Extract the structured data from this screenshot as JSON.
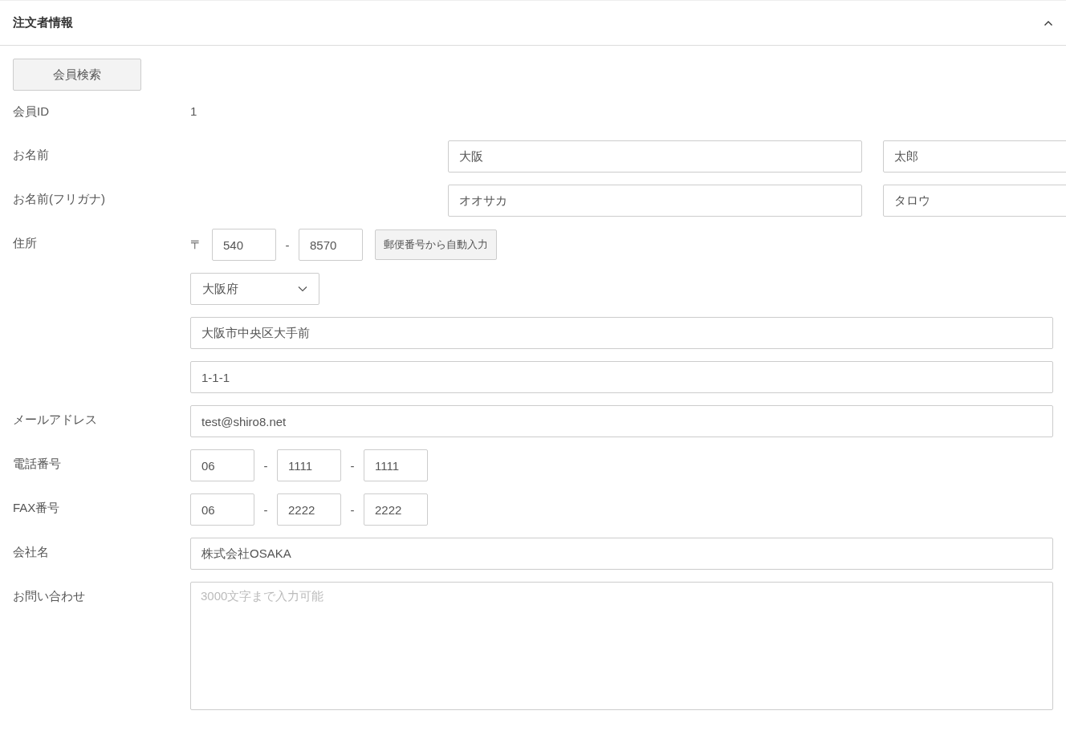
{
  "panel": {
    "title": "注文者情報",
    "expanded": true,
    "search_button": "会員検索"
  },
  "rows": [
    {
      "kind": "text",
      "label": "会員ID",
      "value": "1"
    },
    {
      "kind": "pair",
      "label": "お名前",
      "values": [
        "大阪",
        "太郎"
      ]
    },
    {
      "kind": "pair",
      "label": "お名前(フリガナ)",
      "values": [
        "オオサカ",
        "タロウ"
      ]
    },
    {
      "kind": "address",
      "label": "住所",
      "postal_mark": "〒",
      "zip": [
        "540",
        "8570"
      ],
      "zip_separator": "-",
      "autofill_button": "郵便番号から自動入力",
      "prefecture": "大阪府",
      "city": "大阪市中央区大手前",
      "street": "1-1-1"
    },
    {
      "kind": "wide",
      "label": "メールアドレス",
      "value": "test@shiro8.net"
    },
    {
      "kind": "phone",
      "label": "電話番号",
      "parts": [
        "06",
        "1111",
        "1111"
      ],
      "separators": [
        "-",
        "-"
      ]
    },
    {
      "kind": "phone",
      "label": "FAX番号",
      "parts": [
        "06",
        "2222",
        "2222"
      ],
      "separators": [
        "-",
        "-"
      ]
    },
    {
      "kind": "wide",
      "label": "会社名",
      "value": "株式会社OSAKA"
    },
    {
      "kind": "textarea",
      "label": "お問い合わせ",
      "placeholder": "3000文字まで入力可能"
    }
  ]
}
